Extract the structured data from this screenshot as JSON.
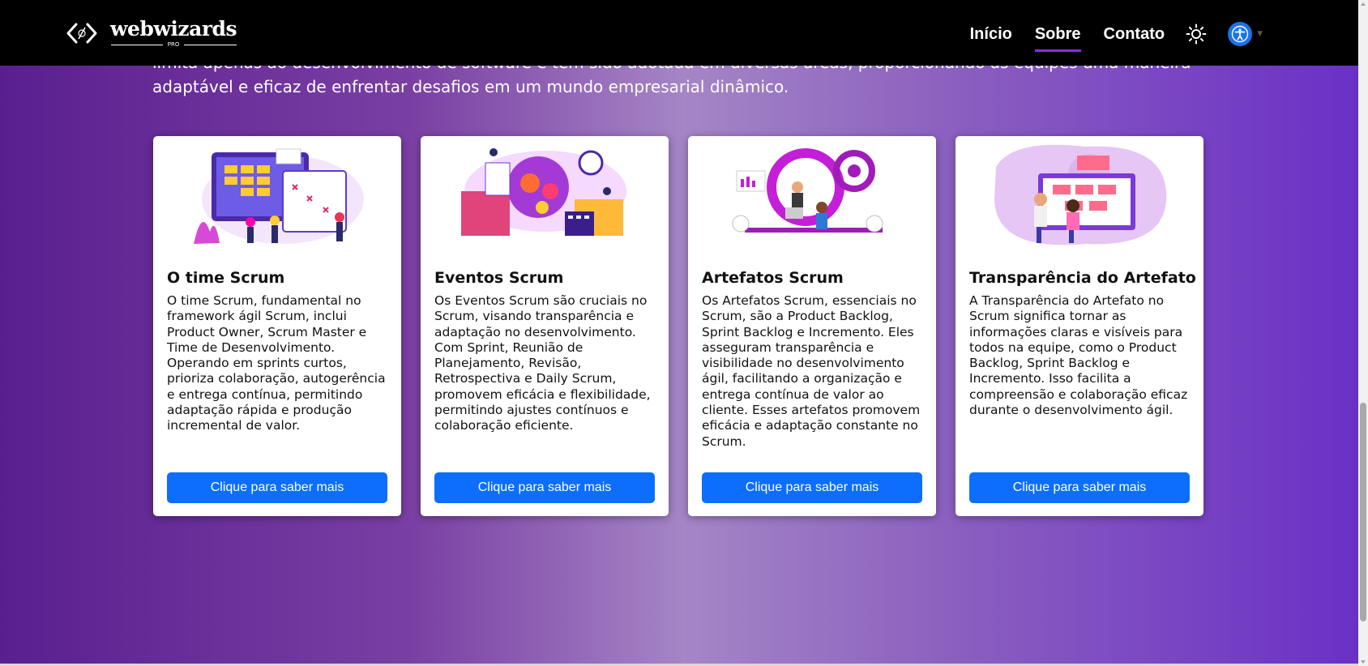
{
  "header": {
    "brand": "webwizards",
    "brand_sub": "PRO",
    "nav": [
      {
        "label": "Início",
        "active": false
      },
      {
        "label": "Sobre",
        "active": true
      },
      {
        "label": "Contato",
        "active": false
      }
    ],
    "theme_icon": "sun-icon",
    "accessibility_icon": "accessibility-icon",
    "accent_color": "#8b2be2"
  },
  "intro": {
    "line1": "limita apenas ao desenvolvimento de software e tem sido adotada em diversas áreas, proporcionando às equipes uma maneira",
    "line2": "adaptável e eficaz de enfrentar desafios em um mundo empresarial dinâmico."
  },
  "cards": [
    {
      "title": "O time Scrum",
      "text": "O time Scrum, fundamental no framework ágil Scrum, inclui Product Owner, Scrum Master e Time de Desenvolvimento. Operando em sprints curtos, prioriza colaboração, autogerência e entrega contínua, permitindo adaptação rápida e produção incremental de valor.",
      "button": "Clique para saber mais"
    },
    {
      "title": "Eventos Scrum",
      "text": "Os Eventos Scrum são cruciais no Scrum, visando transparência e adaptação no desenvolvimento. Com Sprint, Reunião de Planejamento, Revisão, Retrospectiva e Daily Scrum, promovem eficácia e flexibilidade, permitindo ajustes contínuos e colaboração eficiente.",
      "button": "Clique para saber mais"
    },
    {
      "title": "Artefatos Scrum",
      "text": "Os Artefatos Scrum, essenciais no Scrum, são a Product Backlog, Sprint Backlog e Incremento. Eles asseguram transparência e visibilidade no desenvolvimento ágil, facilitando a organização e entrega contínua de valor ao cliente. Esses artefatos promovem eficácia e adaptação constante no Scrum.",
      "button": "Clique para saber mais"
    },
    {
      "title": "Transparência do Artefato",
      "text": "A Transparência do Artefato no Scrum significa tornar as informações claras e visíveis para todos na equipe, como o Product Backlog, Sprint Backlog e Incremento. Isso facilita a compreensão e colaboração eficaz durante o desenvolvimento ágil.",
      "button": "Clique para saber mais"
    }
  ],
  "colors": {
    "button": "#0d6efd",
    "navbar": "#000000"
  }
}
